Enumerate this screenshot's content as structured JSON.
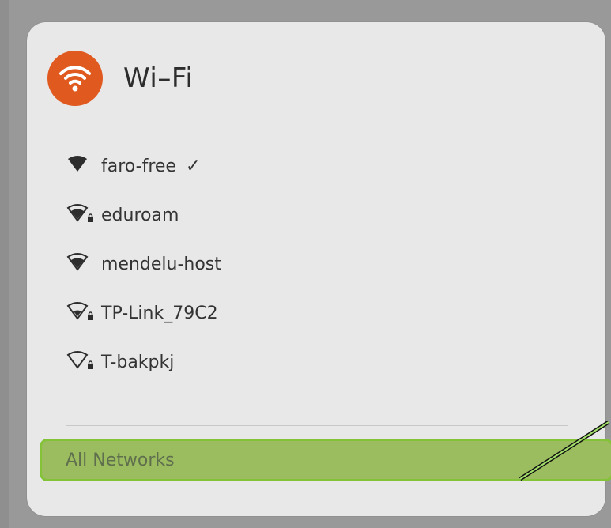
{
  "panel": {
    "title": "Wi–Fi"
  },
  "networks": [
    {
      "name": "faro-free",
      "signal": "full",
      "secured": false,
      "connected": true
    },
    {
      "name": "eduroam",
      "signal": "medium",
      "secured": true,
      "connected": false
    },
    {
      "name": "mendelu-host",
      "signal": "medium",
      "secured": false,
      "connected": false
    },
    {
      "name": "TP-Link_79C2",
      "signal": "low",
      "secured": true,
      "connected": false
    },
    {
      "name": "T-bakpkj",
      "signal": "none",
      "secured": true,
      "connected": false
    }
  ],
  "all_networks_label": "All Networks",
  "colors": {
    "accent": "#e05a20",
    "highlight": "#9bbd60",
    "highlight_border": "#84c23a"
  }
}
